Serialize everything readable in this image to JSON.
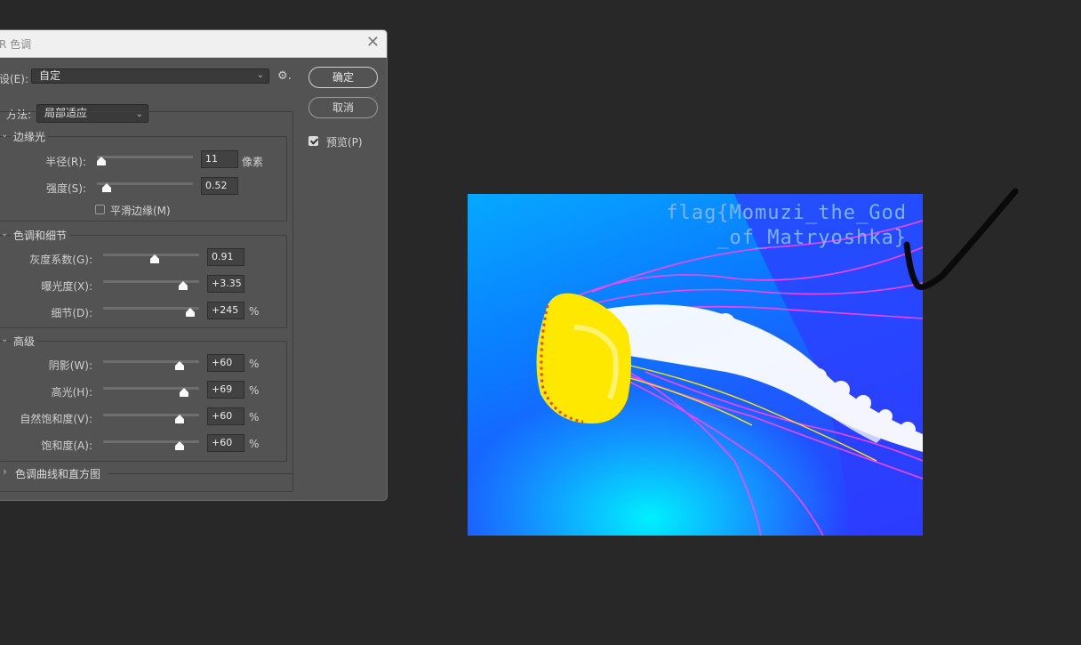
{
  "dialog": {
    "title": "R 色调",
    "close_glyph": "✕",
    "preset": {
      "label": "设(E):",
      "value": "自定",
      "gear": "⚙."
    },
    "ok_label": "确定",
    "cancel_label": "取消",
    "preview": {
      "label": "预览(P)",
      "checked": true
    },
    "method": {
      "label": "方法:",
      "value": "局部适应"
    },
    "edge_glow": {
      "title": "边缘光",
      "radius": {
        "label": "半径(R):",
        "value": "11",
        "unit": "像素"
      },
      "strength": {
        "label": "强度(S):",
        "value": "0.52"
      },
      "smooth": {
        "label": "平滑边缘(M)",
        "checked": false
      }
    },
    "tone_detail": {
      "title": "色调和细节",
      "gamma": {
        "label": "灰度系数(G):",
        "value": "0.91"
      },
      "exposure": {
        "label": "曝光度(X):",
        "value": "+3.35"
      },
      "detail": {
        "label": "细节(D):",
        "value": "+245",
        "unit": "%"
      }
    },
    "advanced": {
      "title": "高级",
      "shadow": {
        "label": "阴影(W):",
        "value": "+60",
        "unit": "%"
      },
      "highlight": {
        "label": "高光(H):",
        "value": "+69",
        "unit": "%"
      },
      "vibrance": {
        "label": "自然饱和度(V):",
        "value": "+60",
        "unit": "%"
      },
      "saturation": {
        "label": "饱和度(A):",
        "value": "+60",
        "unit": "%"
      }
    },
    "curves": {
      "title": "色调曲线和直方图"
    }
  },
  "canvas": {
    "flag_line1": "flag{Momuzi_the_God",
    "flag_line2": "_of_Matryoshka}"
  },
  "colors": {
    "app_background": "#282828",
    "dialog_background": "#535353",
    "flag_text": "#7fb2ff",
    "jellyfish_bell": "#ffe000",
    "tentacles": "#ff3cff"
  }
}
